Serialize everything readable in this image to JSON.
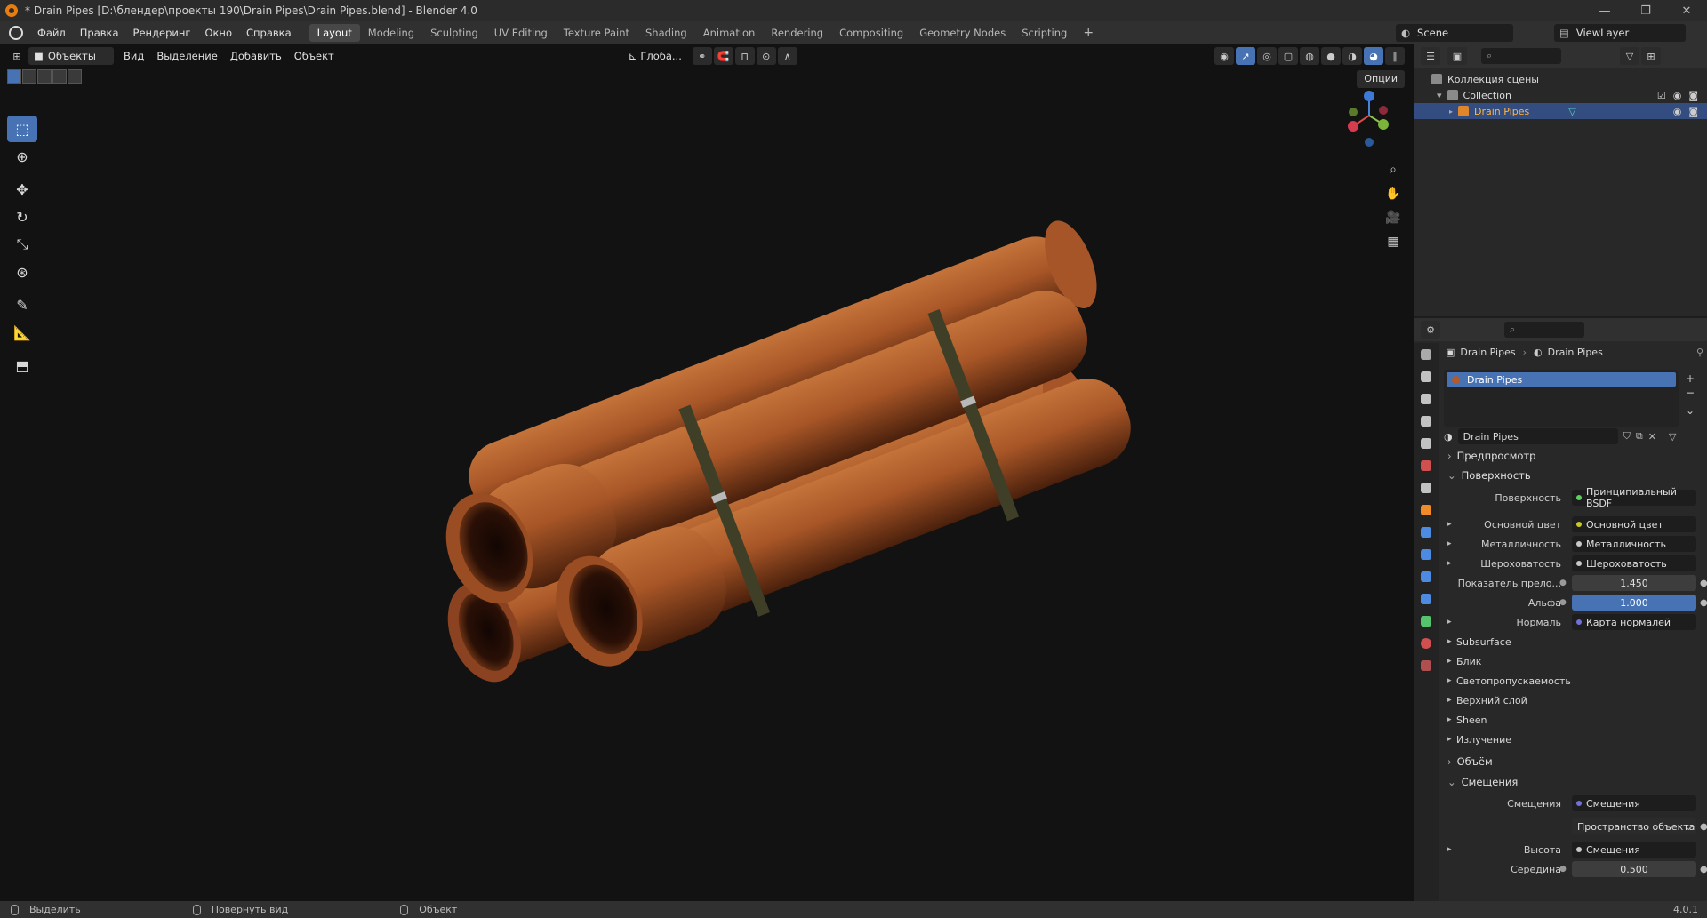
{
  "window": {
    "title": "* Drain Pipes [D:\\блендер\\проекты 190\\Drain Pipes\\Drain Pipes.blend] - Blender 4.0"
  },
  "menu": [
    "Файл",
    "Правка",
    "Рендеринг",
    "Окно",
    "Справка"
  ],
  "workspaces": [
    "Layout",
    "Modeling",
    "Sculpting",
    "UV Editing",
    "Texture Paint",
    "Shading",
    "Animation",
    "Rendering",
    "Compositing",
    "Geometry Nodes",
    "Scripting"
  ],
  "scene": "Scene",
  "viewlayer": "ViewLayer",
  "viewport": {
    "mode": "Объекты",
    "menus": [
      "Вид",
      "Выделение",
      "Добавить",
      "Объект"
    ],
    "orientation": "Глоба...",
    "options": "Опции"
  },
  "outliner": {
    "root": "Коллекция сцены",
    "collection": "Collection",
    "object": "Drain Pipes"
  },
  "properties": {
    "breadcrumb_obj": "Drain Pipes",
    "breadcrumb_mat": "Drain Pipes",
    "slot": "Drain Pipes",
    "material_name": "Drain Pipes",
    "sec_preview": "Предпросмотр",
    "sec_surface": "Поверхность",
    "surface_label": "Поверхность",
    "surface_value": "Принципиальный BSDF",
    "rows": [
      {
        "label": "Основной цвет",
        "value": "Основной цвет",
        "dot": "#c7c729"
      },
      {
        "label": "Металличность",
        "value": "Металличность",
        "dot": "#a0a0a0"
      },
      {
        "label": "Шероховатость",
        "value": "Шероховатость",
        "dot": "#a0a0a0"
      }
    ],
    "ior_label": "Показатель прело...",
    "ior_value": "1.450",
    "alpha_label": "Альфа",
    "alpha_value": "1.000",
    "normal_label": "Нормаль",
    "normal_value": "Карта нормалей",
    "subs": [
      "Subsurface",
      "Блик",
      "Светопропускаемость",
      "Верхний слой",
      "Sheen",
      "Излучение"
    ],
    "sec_volume": "Объём",
    "sec_disp": "Смещения",
    "disp_label": "Смещения",
    "disp_value": "Смещения",
    "space_value": "Пространство объекта",
    "height_label": "Высота",
    "height_value": "Смещения",
    "mid_label": "Середина",
    "mid_value": "0.500"
  },
  "status": {
    "select": "Выделить",
    "rotate": "Повернуть вид",
    "object": "Объект",
    "version": "4.0.1"
  }
}
